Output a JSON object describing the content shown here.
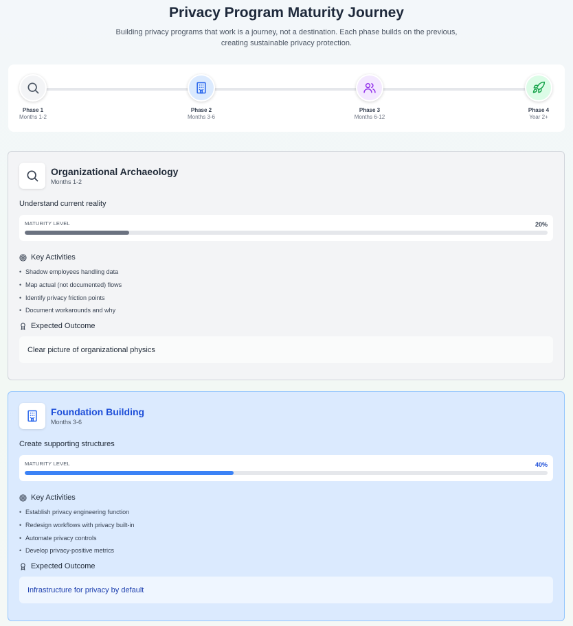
{
  "header": {
    "title": "Privacy Program Maturity Journey",
    "subtitle_line1": "Building privacy programs that work is a journey, not a destination. Each phase builds on the previous,",
    "subtitle_line2": "creating sustainable privacy protection."
  },
  "timeline": {
    "phases": [
      {
        "name": "Phase 1",
        "time": "Months 1-2",
        "icon": "search-icon",
        "color": "#f3f4f6",
        "icon_color": "#4b5563"
      },
      {
        "name": "Phase 2",
        "time": "Months 3-6",
        "icon": "building-icon",
        "color": "#dbeafe",
        "icon_color": "#2563eb"
      },
      {
        "name": "Phase 3",
        "time": "Months 6-12",
        "icon": "users-icon",
        "color": "#f3e8ff",
        "icon_color": "#9333ea"
      },
      {
        "name": "Phase 4",
        "time": "Year 2+",
        "icon": "rocket-icon",
        "color": "#dcfce7",
        "icon_color": "#16a34a"
      }
    ]
  },
  "cards": [
    {
      "title": "Organizational Archaeology",
      "time": "Months 1-2",
      "goal": "Understand current reality",
      "maturity_label": "MATURITY LEVEL",
      "maturity_value": 20,
      "maturity_text": "20%",
      "activities_label": "Key Activities",
      "activities": [
        "Shadow employees handling data",
        "Map actual (not documented) flows",
        "Identify privacy friction points",
        "Document workarounds and why"
      ],
      "outcome_label": "Expected Outcome",
      "outcome": "Clear picture of organizational physics"
    },
    {
      "title": "Foundation Building",
      "time": "Months 3-6",
      "goal": "Create supporting structures",
      "maturity_label": "MATURITY LEVEL",
      "maturity_value": 40,
      "maturity_text": "40%",
      "activities_label": "Key Activities",
      "activities": [
        "Establish privacy engineering function",
        "Redesign workflows with privacy built-in",
        "Automate privacy controls",
        "Develop privacy-positive metrics"
      ],
      "outcome_label": "Expected Outcome",
      "outcome": "Infrastructure for privacy by default"
    }
  ]
}
